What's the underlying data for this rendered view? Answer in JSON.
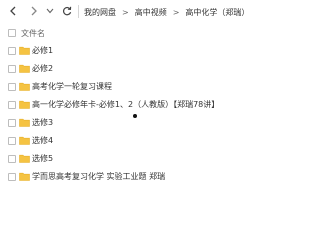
{
  "toolbar": {
    "back_icon": "chevron-left-icon",
    "forward_icon": "chevron-right-icon",
    "history_icon": "chevron-down-icon",
    "refresh_icon": "refresh-icon"
  },
  "breadcrumb": [
    {
      "label": "我的网盘"
    },
    {
      "label": "高中视频"
    },
    {
      "label": "高中化学（郑瑞）"
    }
  ],
  "breadcrumb_separator": ">",
  "list_header": {
    "column_label": "文件名"
  },
  "files": [
    {
      "name": "必修1",
      "type": "folder"
    },
    {
      "name": "必修2",
      "type": "folder"
    },
    {
      "name": "高考化学一轮复习课程",
      "type": "folder"
    },
    {
      "name": "高一化学必修年卡-必修1、2（人教版）【郑瑞78讲】",
      "type": "folder"
    },
    {
      "name": "选修3",
      "type": "folder"
    },
    {
      "name": "选修4",
      "type": "folder"
    },
    {
      "name": "选修5",
      "type": "folder"
    },
    {
      "name": "学而思高考复习化学 实验工业题 郑瑞",
      "type": "folder"
    }
  ],
  "colors": {
    "folder": "#f5c342",
    "folder_tab": "#e8b12c",
    "text": "#333333",
    "checkbox_border": "#bdbdbd"
  }
}
